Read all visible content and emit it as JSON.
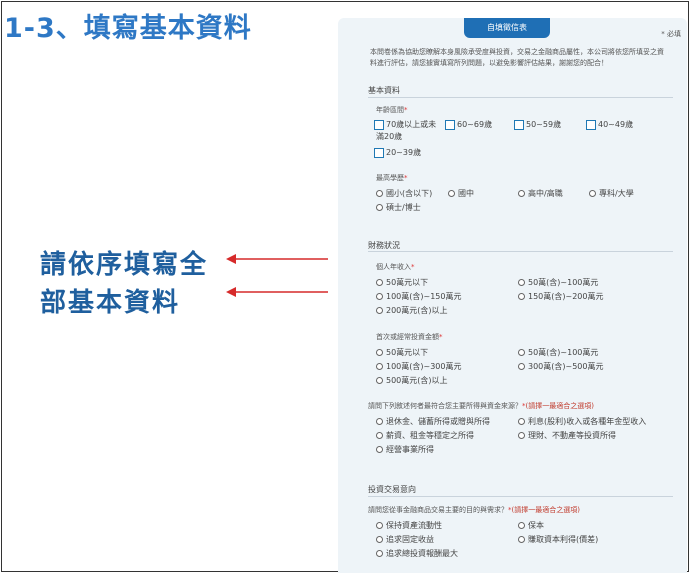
{
  "slide": {
    "title": "1-3、填寫基本資料",
    "note_line1": "請依序填寫全",
    "note_line2": "部基本資料"
  },
  "form": {
    "tab_label": "自填徵信表",
    "required_note": "* 必填",
    "intro": "本問卷係為協助您瞭解本身風險承受度與投資，交易之金融商品屬性，本公司將依您所填妥之資料進行評估，請您據實填寫所列問題，以避免影響評估結果，謝謝您的配合！",
    "sections": {
      "basic": "基本資料",
      "finance": "財務狀況",
      "invest": "投資交易意向"
    },
    "age": {
      "label": "年齡區間",
      "options": [
        "70歲以上或未滿20歲",
        "60~69歲",
        "50~59歲",
        "40~49歲",
        "20~39歲"
      ],
      "opt0_line1": "70歲以上或未",
      "opt0_line2": "滿20歲"
    },
    "education": {
      "label": "最高學歷",
      "options": [
        "國小(含以下)",
        "國中",
        "高中/高職",
        "專科/大學",
        "碩士/博士"
      ]
    },
    "income": {
      "label": "個人年收入",
      "options": [
        "50萬元以下",
        "50萬(含)~100萬元",
        "100萬(含)~150萬元",
        "150萬(含)~200萬元",
        "200萬元(含)以上"
      ]
    },
    "first_invest": {
      "label": "首次或經常投資金額",
      "options": [
        "50萬元以下",
        "50萬(含)~100萬元",
        "100萬(含)~300萬元",
        "300萬(含)~500萬元",
        "500萬元(含)以上"
      ]
    },
    "source": {
      "label": "請問下列敘述何者最符合您主要所得與資金來源？",
      "hint": "(請擇一最適合之選項)",
      "options": [
        "退休金、儲蓄所得或贈與所得",
        "利息(股利)收入或各種年金型收入",
        "薪資、租金等穩定之所得",
        "理財、不動產等投資所得",
        "經營事業所得"
      ]
    },
    "purpose": {
      "label": "請問您從事金融商品交易主要的目的與需求？",
      "hint": "(請擇一最適合之選項)",
      "options": [
        "保持資產流動性",
        "保本",
        "追求固定收益",
        "賺取資本利得(價差)",
        "追求總投資報酬最大"
      ]
    }
  }
}
